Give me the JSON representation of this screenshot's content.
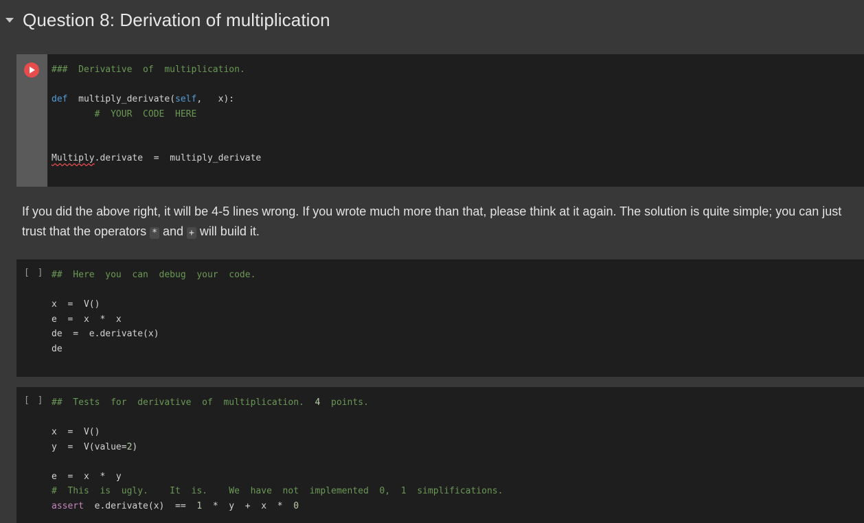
{
  "heading": {
    "title": "Question 8: Derivation of multiplication"
  },
  "cell1": {
    "lines": [
      [
        {
          "t": "###  Derivative  of  multiplication.",
          "c": "comment"
        }
      ],
      [],
      [
        {
          "t": "def",
          "c": "kw"
        },
        {
          "t": "  multiply_derivate(",
          "c": "plain"
        },
        {
          "t": "self",
          "c": "kw"
        },
        {
          "t": ",   x):",
          "c": "plain"
        }
      ],
      [
        {
          "t": "        #  YOUR  CODE  HERE",
          "c": "comment"
        }
      ],
      [],
      [],
      [
        {
          "t": "Multiply",
          "c": "squiggle"
        },
        {
          "t": ".derivate  =  multiply_derivate",
          "c": "plain"
        }
      ]
    ]
  },
  "paragraph": {
    "part1": "If you did the above right, it will be 4-5 lines wrong. If you wrote much more than that, please think at it again. The solution is quite simple; you can just trust that the operators ",
    "code1": "*",
    "part2": " and ",
    "code2": "+",
    "part3": " will build it."
  },
  "cell2": {
    "brackets": "[ ]",
    "lines": [
      [
        {
          "t": "##  Here  you  can  debug  your  code.",
          "c": "comment"
        }
      ],
      [],
      [
        {
          "t": "x  =  V()",
          "c": "plain"
        }
      ],
      [
        {
          "t": "e  =  x  *  x",
          "c": "plain"
        }
      ],
      [
        {
          "t": "de  =  e.derivate(x)",
          "c": "plain"
        }
      ],
      [
        {
          "t": "de",
          "c": "plain"
        }
      ]
    ]
  },
  "cell3": {
    "brackets": "[ ]",
    "lines": [
      [
        {
          "t": "##  Tests  for  derivative  of  multiplication.  ",
          "c": "comment"
        },
        {
          "t": "4",
          "c": "num"
        },
        {
          "t": "  points.",
          "c": "comment"
        }
      ],
      [],
      [
        {
          "t": "x  =  V()",
          "c": "plain"
        }
      ],
      [
        {
          "t": "y  =  V(value=",
          "c": "plain"
        },
        {
          "t": "2",
          "c": "num"
        },
        {
          "t": ")",
          "c": "plain"
        }
      ],
      [],
      [
        {
          "t": "e  =  x  *  y",
          "c": "plain"
        }
      ],
      [
        {
          "t": "#  This  is  ugly.    It  is.    We  have  not  implemented  0,  1  simplifications.",
          "c": "comment"
        }
      ],
      [
        {
          "t": "assert",
          "c": "kw2"
        },
        {
          "t": "  e.derivate(x)  ==  ",
          "c": "plain"
        },
        {
          "t": "1",
          "c": "num"
        },
        {
          "t": "  *  y  +  x  *  ",
          "c": "plain"
        },
        {
          "t": "0",
          "c": "num"
        }
      ]
    ]
  }
}
